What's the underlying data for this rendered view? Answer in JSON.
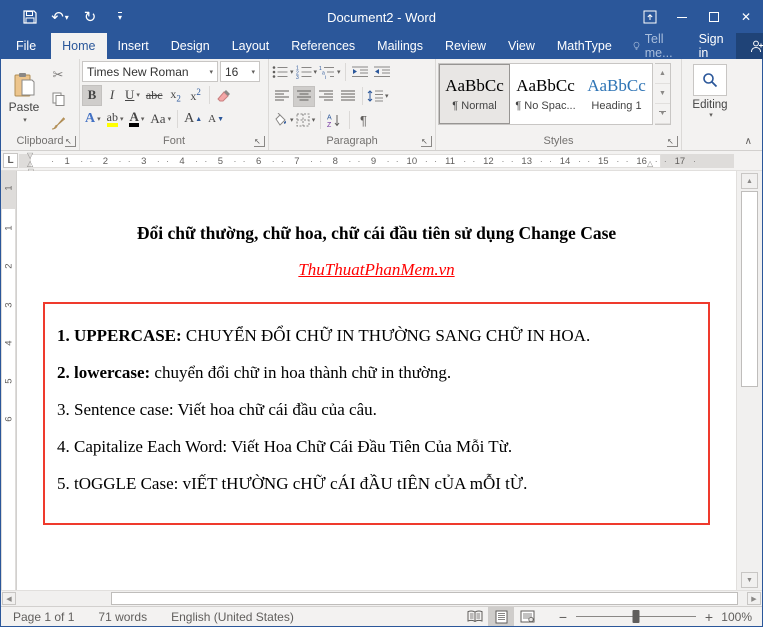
{
  "window": {
    "title": "Document2 - Word"
  },
  "icons": {
    "undo": "↶",
    "redo": "↻",
    "cut": "✂",
    "close": "✕",
    "dropdown": "▾",
    "up_arrow": "▲",
    "down_arrow": "▼",
    "left_arrow": "◀",
    "right_arrow": "▶",
    "collapse": "∧",
    "pilcrow": "¶",
    "launcher": "◿",
    "marker_firstline": "▽",
    "marker_hanging": "△",
    "marker_box": "▭",
    "marker_right": "△"
  },
  "tabs": {
    "items": [
      {
        "label": "File"
      },
      {
        "label": "Home"
      },
      {
        "label": "Insert"
      },
      {
        "label": "Design"
      },
      {
        "label": "Layout"
      },
      {
        "label": "References"
      },
      {
        "label": "Mailings"
      },
      {
        "label": "Review"
      },
      {
        "label": "View"
      },
      {
        "label": "MathType"
      }
    ],
    "tell_me": "Tell me...",
    "sign_in": "Sign in",
    "share": "Share"
  },
  "ribbon": {
    "clipboard": {
      "label": "Clipboard",
      "paste": "Paste"
    },
    "font": {
      "label": "Font",
      "family": "Times New Roman",
      "size": "16",
      "bold": "B",
      "italic": "I",
      "underline": "U",
      "strike": "abc",
      "effects": "A",
      "highlight": "ab",
      "color": "A",
      "change_case": "Aa",
      "grow": "A",
      "shrink": "A"
    },
    "paragraph": {
      "label": "Paragraph",
      "sort": "A↓Z",
      "pilcrow": "¶"
    },
    "styles": {
      "label": "Styles",
      "items": [
        {
          "preview": "AaBbCc",
          "name": "¶ Normal",
          "selected": true
        },
        {
          "preview": "AaBbCc",
          "name": "¶ No Spac...",
          "selected": false
        },
        {
          "preview": "AaBbCc",
          "name": "Heading 1",
          "selected": false
        }
      ]
    },
    "editing": {
      "label": "Editing"
    }
  },
  "ruler": {
    "numbers_h": [
      1,
      2,
      3,
      4,
      5,
      6,
      7,
      8,
      9,
      10,
      11,
      12,
      13,
      14,
      15,
      16,
      17
    ],
    "numbers_v": [
      1,
      2,
      3,
      4,
      5,
      6
    ],
    "margin_number": "1"
  },
  "document": {
    "title": "Đổi chữ thường, chữ hoa, chữ cái đầu tiên sử dụng Change Case",
    "link": "ThuThuatPhanMem.vn",
    "items": [
      {
        "lead": "1. UPPERCASE:",
        "text": " CHUYỂN ĐỔI CHỮ IN THƯỜNG SANG CHỮ IN HOA."
      },
      {
        "lead": "2. lowercase:",
        "text": " chuyển đổi chữ in hoa thành chữ in thường."
      },
      {
        "lead": "",
        "text": "3. Sentence case: Viết hoa chữ cái đầu của câu."
      },
      {
        "lead": "",
        "text": "4. Capitalize Each Word: Viết Hoa Chữ Cái Đầu Tiên Của Mỗi Từ."
      },
      {
        "lead": "",
        "text": "5. tOGGLE Case: vIẾT tHƯỜNG cHỮ cÁI đẦU tIÊN cỦA mỖI tỪ."
      }
    ]
  },
  "status": {
    "page": "Page 1 of 1",
    "words": "71 words",
    "language": "English (United States)",
    "zoom": "100%"
  },
  "colors": {
    "titlebar": "#2b579a",
    "share_bg": "#1f4377",
    "link": "#ff0000",
    "box_border": "#ef3a2d",
    "heading_style": "#2e74b5",
    "highlight_yellow": "#ffff00"
  }
}
